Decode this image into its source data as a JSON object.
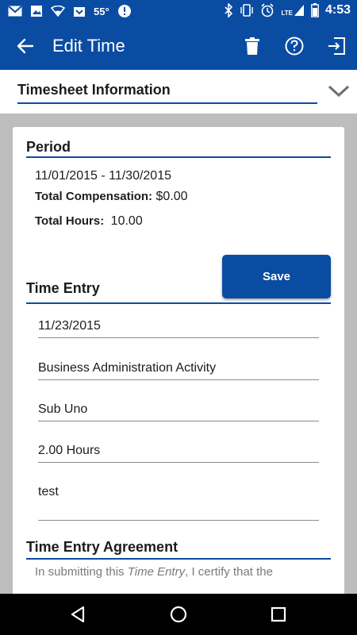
{
  "status_bar": {
    "temperature": "55°",
    "network": "LTE",
    "time": "4:53",
    "icons": [
      "gmail-icon",
      "image-icon",
      "wifi-icon",
      "store-icon",
      "alert-icon",
      "bluetooth-icon",
      "vibrate-icon",
      "alarm-icon",
      "signal-icon",
      "battery-icon"
    ]
  },
  "app_bar": {
    "title": "Edit Time",
    "icons": [
      "back-arrow-icon",
      "delete-icon",
      "help-icon",
      "logout-icon"
    ]
  },
  "section": {
    "title": "Timesheet Information"
  },
  "period": {
    "title": "Period",
    "date_range": "11/01/2015 - 11/30/2015",
    "compensation_label": "Total Compensation:",
    "compensation_value": "$0.00",
    "hours_label": "Total Hours:",
    "hours_value": "10.00"
  },
  "save_label": "Save",
  "time_entry": {
    "title": "Time Entry",
    "date": "11/23/2015",
    "activity": "Business Administration Activity",
    "sub": "Sub Uno",
    "hours": "2.00 Hours",
    "notes": "test"
  },
  "agreement": {
    "title": "Time Entry Agreement",
    "text_before": "In submitting this ",
    "text_italic": "Time Entry",
    "text_after": ", I certify that the"
  },
  "colors": {
    "primary": "#0b4ca3",
    "background_gray": "#bdbdbd"
  }
}
